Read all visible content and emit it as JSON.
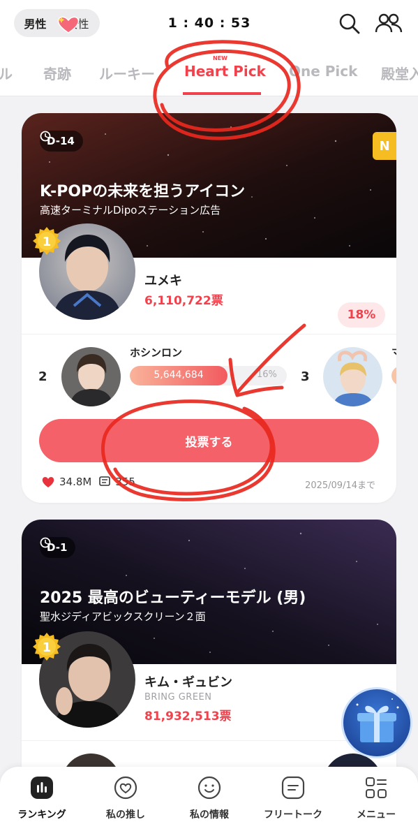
{
  "header": {
    "gender_male": "男性",
    "gender_female": "女性",
    "timer": "1 : 40 : 53",
    "icons": [
      "search-icon",
      "people-icon"
    ]
  },
  "tabs": {
    "items": [
      {
        "label": "ル"
      },
      {
        "label": "奇跡"
      },
      {
        "label": "ルーキー"
      },
      {
        "label": "Heart Pick",
        "active": true,
        "new_badge": "NEW"
      },
      {
        "label": "One Pick"
      },
      {
        "label": "殿堂入"
      }
    ]
  },
  "cards": [
    {
      "dday": "D-14",
      "title": "K-POPの未来を担うアイコン",
      "subtitle": "高速ターミナルDipoステーション広告",
      "n_badge": "N",
      "first": {
        "rank": "1",
        "name": "ユメキ",
        "votes": "6,110,722票",
        "percent": "18%"
      },
      "runners": [
        {
          "rank": "2",
          "name": "ホシンロン",
          "votes": "5,644,684",
          "percent": "16%",
          "fill": 0.62
        },
        {
          "rank": "3",
          "name": "マ"
        }
      ],
      "vote_button": "投票する",
      "hearts": "34.8M",
      "comments": "355",
      "deadline": "2025/09/14まで"
    },
    {
      "dday": "D-1",
      "title": "2025 最高のビューティーモデル (男)",
      "subtitle": "聖水ジディアビックスクリーン２面",
      "first": {
        "rank": "1",
        "name": "キム・ギュビン",
        "agency": "BRING GREEN",
        "votes": "81,932,513票"
      }
    }
  ],
  "bottom_nav": [
    {
      "label": "ランキング",
      "icon": "ranking-icon",
      "active": true
    },
    {
      "label": "私の推し",
      "icon": "heart-icon"
    },
    {
      "label": "私の情報",
      "icon": "smile-icon"
    },
    {
      "label": "フリートーク",
      "icon": "chat-icon"
    },
    {
      "label": "メニュー",
      "icon": "menu-icon"
    }
  ],
  "colors": {
    "accent": "#f0424d",
    "vote_button": "#f56168",
    "medal": "#f6bd22",
    "annotation": "#e8281e"
  }
}
